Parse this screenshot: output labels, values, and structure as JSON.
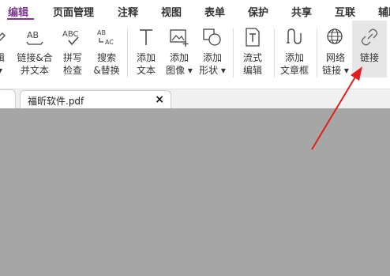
{
  "menu": {
    "tabs": [
      "编辑",
      "页面管理",
      "注释",
      "视图",
      "表单",
      "保护",
      "共享",
      "互联",
      "辅助"
    ]
  },
  "ribbon": {
    "tools": [
      {
        "label": "辑\n▾",
        "icon": "edit-icon"
      },
      {
        "label": "链接&合\n并文本",
        "icon": "text-link-icon"
      },
      {
        "label": "拼写\n检查",
        "icon": "spell-check-icon"
      },
      {
        "label": "搜索\n&替换",
        "icon": "search-replace-icon"
      },
      {
        "label": "添加\n文本",
        "icon": "text-icon"
      },
      {
        "label": "添加\n图像 ▾",
        "icon": "image-icon"
      },
      {
        "label": "添加\n形状 ▾",
        "icon": "shape-icon"
      },
      {
        "label": "流式\n编辑",
        "icon": "flow-edit-icon"
      },
      {
        "label": "添加\n文章框",
        "icon": "article-box-icon"
      },
      {
        "label": "网络\n链接 ▾",
        "icon": "globe-link-icon"
      },
      {
        "label": "链接",
        "icon": "chain-link-icon"
      }
    ]
  },
  "document_tab": {
    "filename": "福昕软件.pdf",
    "close_glyph": "×"
  },
  "colors": {
    "accent": "#7a3b8f",
    "arrow": "#e02020",
    "workspace": "#a6a6a6"
  }
}
